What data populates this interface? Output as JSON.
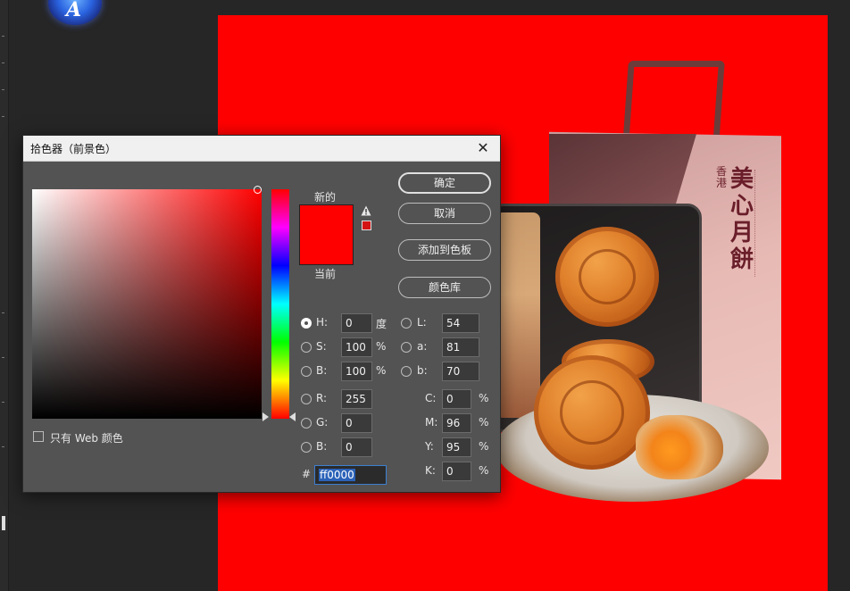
{
  "dialog": {
    "title": "拾色器（前景色）",
    "new_label": "新的",
    "current_label": "当前",
    "new_color": "#ff0000",
    "current_color": "#ff0000",
    "buttons": {
      "ok": "确定",
      "cancel": "取消",
      "add_to_swatches": "添加到色板",
      "color_libraries": "颜色库"
    },
    "web_only_label": "只有 Web 颜色",
    "web_only_checked": false,
    "hsb": {
      "h": {
        "label": "H:",
        "value": "0",
        "unit": "度",
        "selected": true
      },
      "s": {
        "label": "S:",
        "value": "100",
        "unit": "%"
      },
      "b": {
        "label": "B:",
        "value": "100",
        "unit": "%"
      }
    },
    "rgb": {
      "r": {
        "label": "R:",
        "value": "255"
      },
      "g": {
        "label": "G:",
        "value": "0"
      },
      "b": {
        "label": "B:",
        "value": "0"
      }
    },
    "lab": {
      "l": {
        "label": "L:",
        "value": "54"
      },
      "a": {
        "label": "a:",
        "value": "81"
      },
      "b": {
        "label": "b:",
        "value": "70"
      }
    },
    "cmyk": {
      "c": {
        "label": "C:",
        "value": "0",
        "unit": "%"
      },
      "m": {
        "label": "M:",
        "value": "96",
        "unit": "%"
      },
      "y": {
        "label": "Y:",
        "value": "95",
        "unit": "%"
      },
      "k": {
        "label": "K:",
        "value": "0",
        "unit": "%"
      }
    },
    "hex": {
      "label": "#",
      "value": "ff0000"
    }
  },
  "canvas": {
    "background": "#ff0000",
    "bag_brand_small": "香港",
    "bag_brand_large": "美心月餅"
  },
  "icons": {
    "close": "close-icon",
    "warning": "out-of-gamut-warning-icon",
    "app_logo": "app-logo-icon"
  }
}
